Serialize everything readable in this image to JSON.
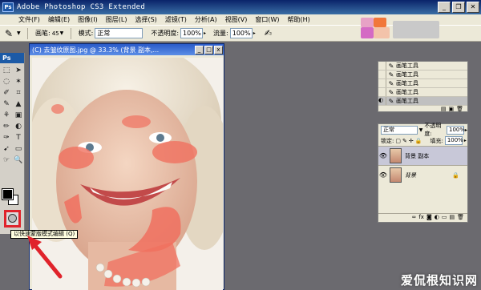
{
  "window": {
    "title": "Adobe Photoshop CS3 Extended",
    "app_icon": "Ps",
    "minimize": "_",
    "restore": "❐",
    "close": "✕"
  },
  "menu": [
    "文件(F)",
    "编辑(E)",
    "图像(I)",
    "图层(L)",
    "选择(S)",
    "滤镜(T)",
    "分析(A)",
    "视图(V)",
    "窗口(W)",
    "帮助(H)"
  ],
  "options": {
    "brush_label": "画笔:",
    "brush_size": "45",
    "mode_label": "模式:",
    "mode_value": "正常",
    "opacity_label": "不透明度:",
    "opacity_value": "100%",
    "flow_label": "流量:",
    "flow_value": "100%"
  },
  "tools": {
    "panel_title": "Ps",
    "items": [
      "⬚",
      "➤",
      "◌",
      "✶",
      "✐",
      "⌗",
      "✎",
      "▲",
      "⚘",
      "▣",
      "✏",
      "◐",
      "✑",
      "T",
      "➹",
      "▭",
      "☞",
      "🔍"
    ]
  },
  "tooltip": "以快速蒙版模式编辑 (Q)",
  "document": {
    "title": "(C) 去皱纹原图.jpg @ 33.3% (背景 副本,...",
    "minimize": "_",
    "maximize": "□",
    "close": "x"
  },
  "history": {
    "rows": [
      {
        "label": "画笔工具",
        "selected": false
      },
      {
        "label": "画笔工具",
        "selected": false
      },
      {
        "label": "画笔工具",
        "selected": false
      },
      {
        "label": "画笔工具",
        "selected": false
      },
      {
        "label": "画笔工具",
        "selected": true
      }
    ],
    "footer_icons": [
      "▤",
      "▣",
      "🗑"
    ]
  },
  "layers": {
    "blend_mode": "正常",
    "opacity_label": "不透明度:",
    "opacity_value": "100%",
    "lock_label": "锁定:",
    "fill_label": "填充:",
    "fill_value": "100%",
    "rows": [
      {
        "name": "背景 副本",
        "selected": true,
        "locked": false
      },
      {
        "name": "背景",
        "selected": false,
        "locked": true
      }
    ],
    "footer_icons": [
      "∞",
      "fx",
      "◙",
      "◐",
      "▭",
      "▤",
      "🗑"
    ]
  },
  "watermark": "爱侃根知识网"
}
